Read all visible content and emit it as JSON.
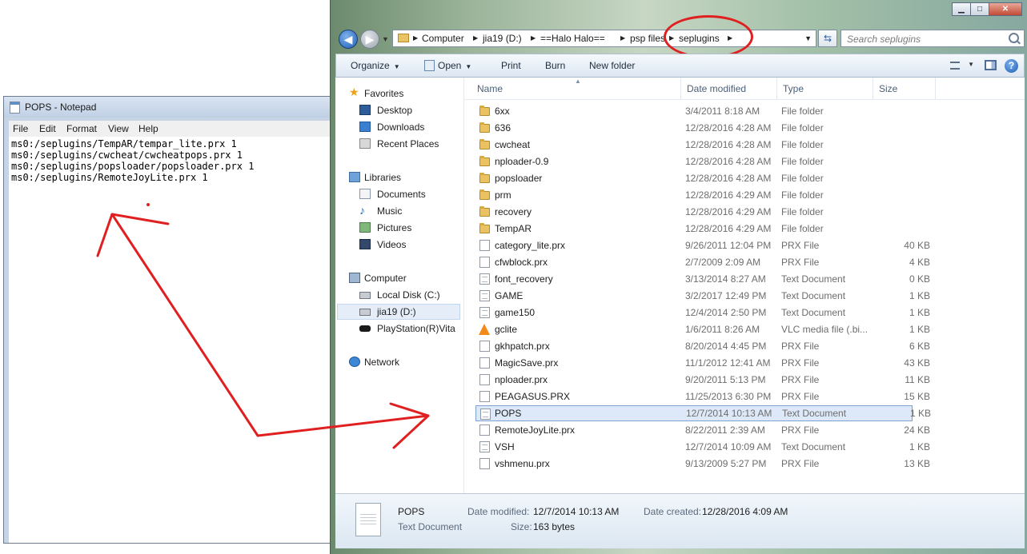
{
  "notepad": {
    "title": "POPS - Notepad",
    "menu": [
      "File",
      "Edit",
      "Format",
      "View",
      "Help"
    ],
    "content": "ms0:/seplugins/TempAR/tempar_lite.prx 1\nms0:/seplugins/cwcheat/cwcheatpops.prx 1\nms0:/seplugins/popsloader/popsloader.prx 1\nms0:/seplugins/RemoteJoyLite.prx 1"
  },
  "explorer": {
    "window_controls": {
      "minimize": "▁",
      "maximize": "□",
      "close": "✕"
    },
    "breadcrumb": [
      "Computer",
      "jia19 (D:)",
      "==Halo Halo==",
      "psp files",
      "seplugins"
    ],
    "search": {
      "placeholder": "Search seplugins"
    },
    "toolbar": {
      "organize": "Organize",
      "open": "Open",
      "print": "Print",
      "burn": "Burn",
      "new_folder": "New folder"
    },
    "nav": {
      "favorites": "Favorites",
      "favorites_items": [
        "Desktop",
        "Downloads",
        "Recent Places"
      ],
      "libraries": "Libraries",
      "libraries_items": [
        "Documents",
        "Music",
        "Pictures",
        "Videos"
      ],
      "computer": "Computer",
      "computer_items": [
        "Local Disk (C:)",
        "jia19 (D:)",
        "PlayStation(R)Vita"
      ],
      "network": "Network"
    },
    "columns": {
      "name": "Name",
      "date": "Date modified",
      "type": "Type",
      "size": "Size"
    },
    "files": [
      {
        "name": "6xx",
        "date": "3/4/2011 8:18 AM",
        "type": "File folder",
        "size": "",
        "icon": "folder"
      },
      {
        "name": "636",
        "date": "12/28/2016 4:28 AM",
        "type": "File folder",
        "size": "",
        "icon": "folder"
      },
      {
        "name": "cwcheat",
        "date": "12/28/2016 4:28 AM",
        "type": "File folder",
        "size": "",
        "icon": "folder"
      },
      {
        "name": "nploader-0.9",
        "date": "12/28/2016 4:28 AM",
        "type": "File folder",
        "size": "",
        "icon": "folder"
      },
      {
        "name": "popsloader",
        "date": "12/28/2016 4:28 AM",
        "type": "File folder",
        "size": "",
        "icon": "folder"
      },
      {
        "name": "prm",
        "date": "12/28/2016 4:29 AM",
        "type": "File folder",
        "size": "",
        "icon": "folder"
      },
      {
        "name": "recovery",
        "date": "12/28/2016 4:29 AM",
        "type": "File folder",
        "size": "",
        "icon": "folder"
      },
      {
        "name": "TempAR",
        "date": "12/28/2016 4:29 AM",
        "type": "File folder",
        "size": "",
        "icon": "folder"
      },
      {
        "name": "category_lite.prx",
        "date": "9/26/2011 12:04 PM",
        "type": "PRX File",
        "size": "40 KB",
        "icon": "file"
      },
      {
        "name": "cfwblock.prx",
        "date": "2/7/2009 2:09 AM",
        "type": "PRX File",
        "size": "4 KB",
        "icon": "file"
      },
      {
        "name": "font_recovery",
        "date": "3/13/2014 8:27 AM",
        "type": "Text Document",
        "size": "0 KB",
        "icon": "text"
      },
      {
        "name": "GAME",
        "date": "3/2/2017 12:49 PM",
        "type": "Text Document",
        "size": "1 KB",
        "icon": "text"
      },
      {
        "name": "game150",
        "date": "12/4/2014 2:50 PM",
        "type": "Text Document",
        "size": "1 KB",
        "icon": "text"
      },
      {
        "name": "gclite",
        "date": "1/6/2011 8:26 AM",
        "type": "VLC media file (.bi...",
        "size": "1 KB",
        "icon": "vlc"
      },
      {
        "name": "gkhpatch.prx",
        "date": "8/20/2014 4:45 PM",
        "type": "PRX File",
        "size": "6 KB",
        "icon": "file"
      },
      {
        "name": "MagicSave.prx",
        "date": "11/1/2012 12:41 AM",
        "type": "PRX File",
        "size": "43 KB",
        "icon": "file"
      },
      {
        "name": "nploader.prx",
        "date": "9/20/2011 5:13 PM",
        "type": "PRX File",
        "size": "11 KB",
        "icon": "file"
      },
      {
        "name": "PEAGASUS.PRX",
        "date": "11/25/2013 6:30 PM",
        "type": "PRX File",
        "size": "15 KB",
        "icon": "file"
      },
      {
        "name": "POPS",
        "date": "12/7/2014 10:13 AM",
        "type": "Text Document",
        "size": "1 KB",
        "icon": "text",
        "selected": true
      },
      {
        "name": "RemoteJoyLite.prx",
        "date": "8/22/2011 2:39 AM",
        "type": "PRX File",
        "size": "24 KB",
        "icon": "file"
      },
      {
        "name": "VSH",
        "date": "12/7/2014 10:09 AM",
        "type": "Text Document",
        "size": "1 KB",
        "icon": "text"
      },
      {
        "name": "vshmenu.prx",
        "date": "9/13/2009 5:27 PM",
        "type": "PRX File",
        "size": "13 KB",
        "icon": "file"
      }
    ],
    "details": {
      "name": "POPS",
      "type": "Text Document",
      "modified_label": "Date modified:",
      "modified": "12/7/2014 10:13 AM",
      "created_label": "Date created:",
      "created": "12/28/2016 4:09 AM",
      "size_label": "Size:",
      "size": "163 bytes"
    }
  },
  "colors": {
    "annotation": "#e02020",
    "selection": "#dde9f8",
    "accent": "#1f5fb8"
  }
}
